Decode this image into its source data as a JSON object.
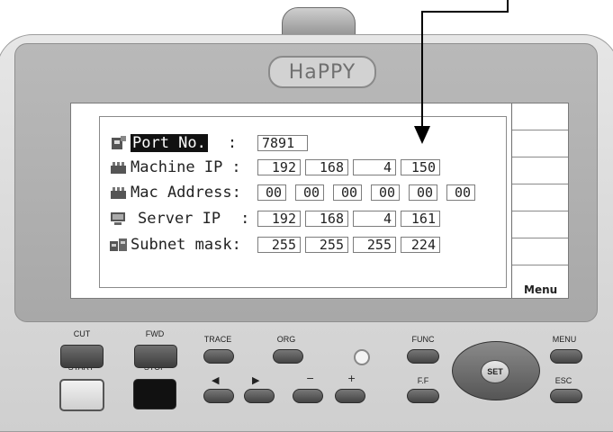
{
  "brand": "HaPPY",
  "screen": {
    "rows": [
      {
        "label": "Port No.",
        "colon": ":",
        "values": [
          "7891"
        ],
        "icon": "port-icon"
      },
      {
        "label": "Machine IP",
        "colon": ":",
        "values": [
          "192",
          "168",
          "4",
          "150"
        ],
        "icon": "machine-icon"
      },
      {
        "label": "Mac Address",
        "colon": ":",
        "values": [
          "00",
          "00",
          "00",
          "00",
          "00",
          "00"
        ],
        "icon": "mac-icon"
      },
      {
        "label": "Server IP",
        "colon": ":",
        "values": [
          "192",
          "168",
          "4",
          "161"
        ],
        "icon": "server-icon"
      },
      {
        "label": "Subnet mask",
        "colon": ":",
        "values": [
          "255",
          "255",
          "255",
          "224"
        ],
        "icon": "subnet-icon"
      }
    ],
    "menu_label": "Menu"
  },
  "keys": {
    "cut": "CUT",
    "fwd": "FWD",
    "trace": "TRACE",
    "org": "ORG",
    "func": "FUNC",
    "menu": "MENU",
    "start": "START",
    "stop": "STOP",
    "ff": "F.F",
    "set": "SET",
    "esc": "ESC",
    "left": "◀",
    "right": "▶",
    "minus": "−",
    "plus": "+"
  }
}
